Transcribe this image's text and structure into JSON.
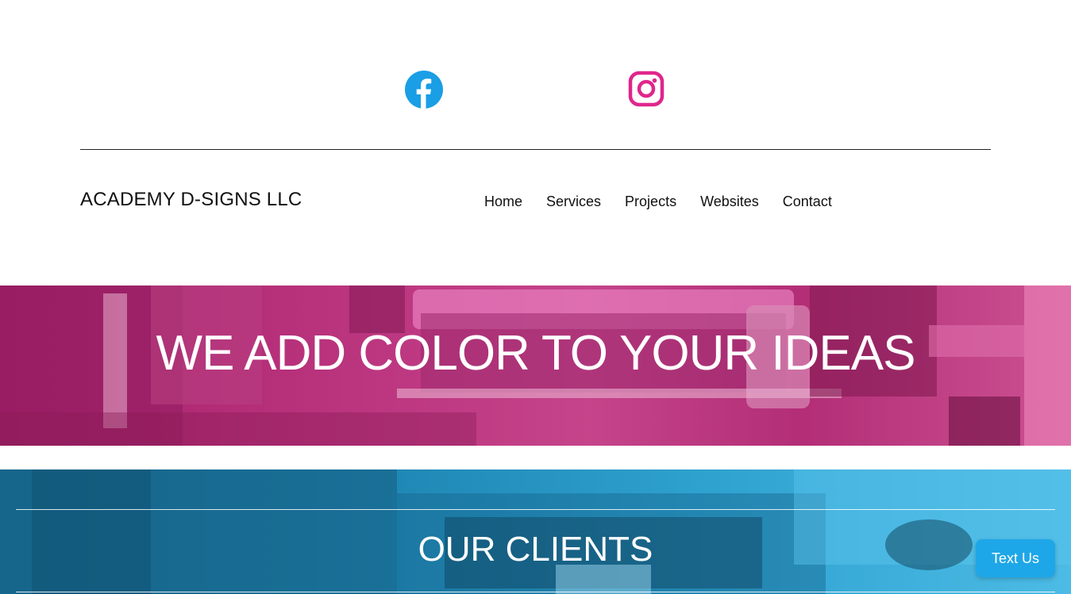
{
  "social": {
    "facebook_icon": "facebook-icon",
    "instagram_icon": "instagram-icon",
    "facebook_color": "#1a9ee6",
    "instagram_color": "#e0268c"
  },
  "header": {
    "brand": "ACADEMY D-SIGNS LLC",
    "nav": [
      "Home",
      "Services",
      "Projects",
      "Websites",
      "Contact"
    ]
  },
  "hero": {
    "headline": "WE ADD COLOR TO YOUR IDEAS",
    "tint_color": "#c23a85"
  },
  "clients": {
    "heading": "OUR CLIENTS",
    "tint_color": "#1f86b3"
  },
  "chat_widget": {
    "label": "Text Us",
    "color": "#1ea7e8"
  }
}
